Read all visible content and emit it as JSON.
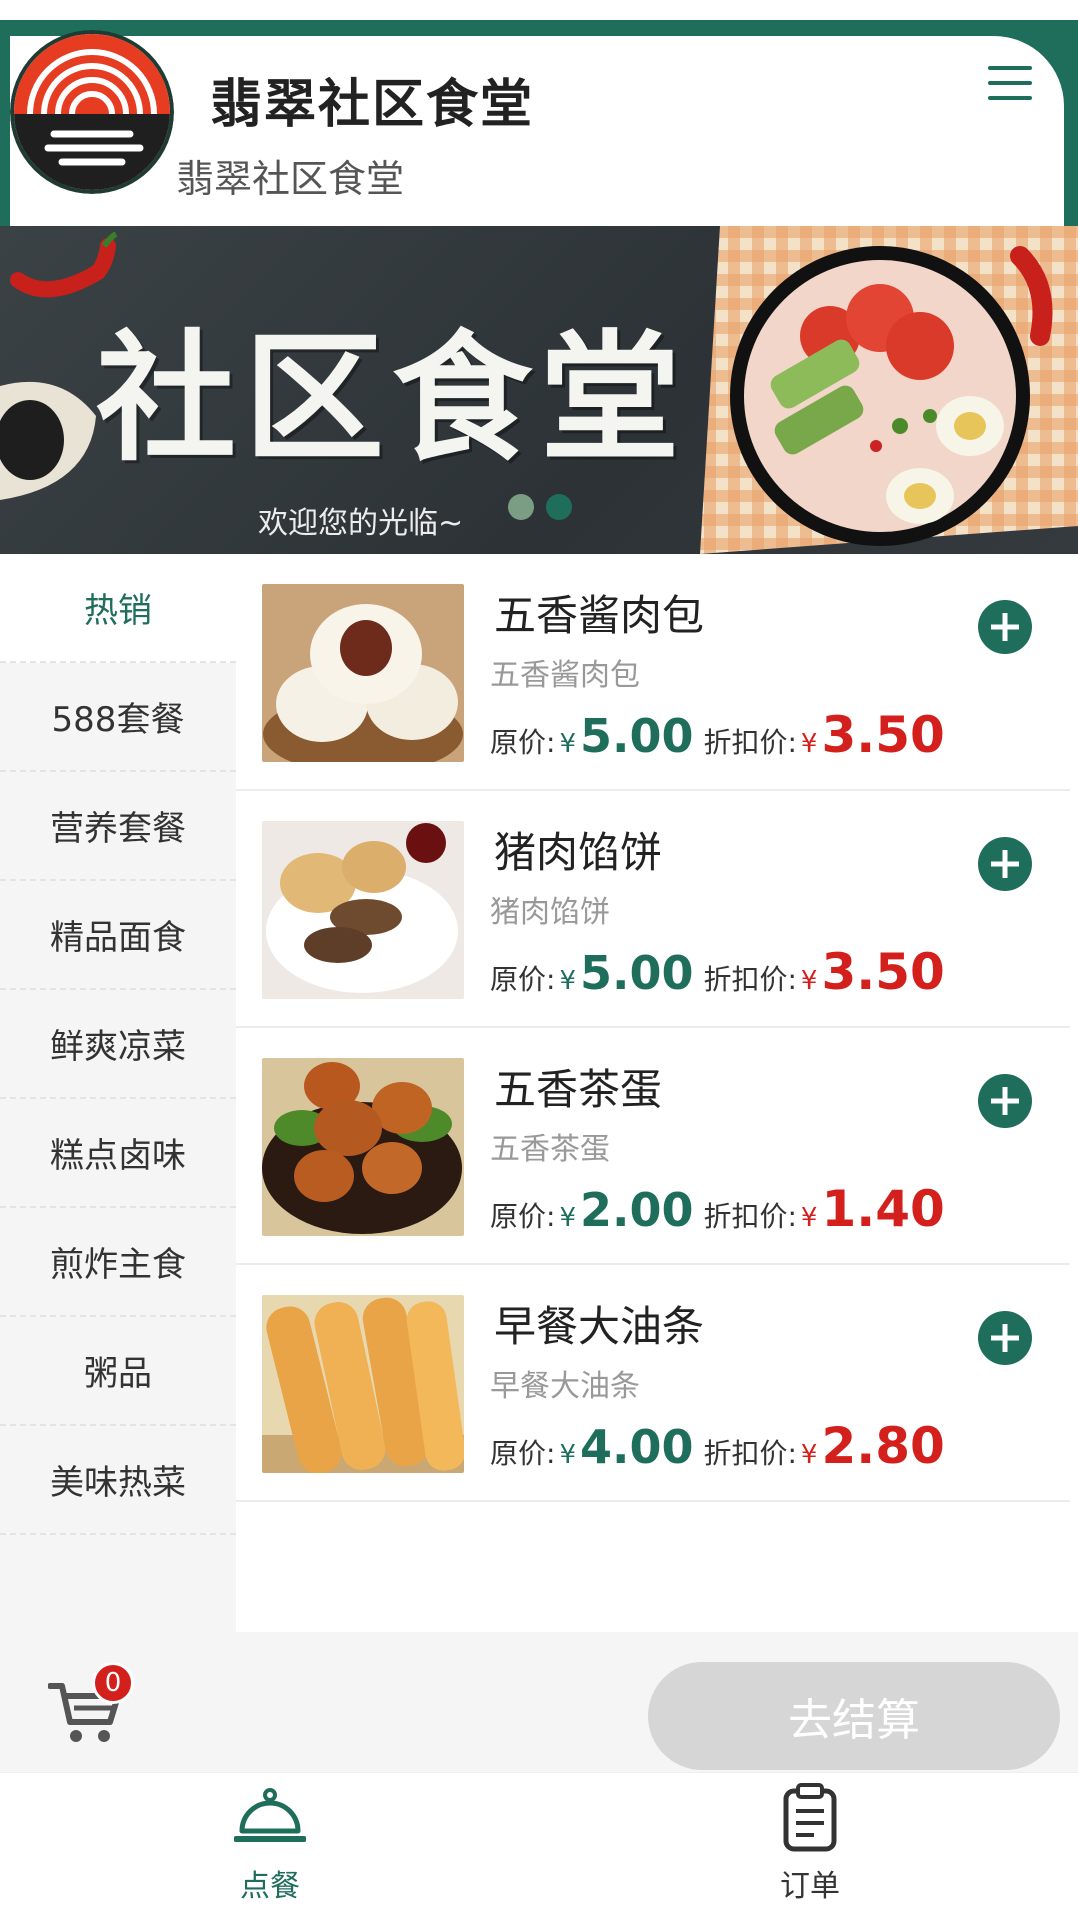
{
  "header": {
    "title": "翡翠社区食堂",
    "subtitle": "翡翠社区食堂",
    "logo_icon": "canteen-logo",
    "menu_icon": "hamburger-menu-icon",
    "accent_color": "#1f6e5c"
  },
  "banner": {
    "title": "社区食堂",
    "subtitle": "欢迎您的光临~",
    "slide_count": 2,
    "active_slide": 2
  },
  "categories": [
    {
      "label": "热销",
      "active": true
    },
    {
      "label": "588套餐"
    },
    {
      "label": "营养套餐"
    },
    {
      "label": "精品面食"
    },
    {
      "label": "鲜爽凉菜"
    },
    {
      "label": "糕点卤味"
    },
    {
      "label": "煎炸主食"
    },
    {
      "label": "粥品"
    },
    {
      "label": "美味热菜"
    }
  ],
  "price_labels": {
    "original": "原价:",
    "discount": "折扣价:",
    "currency": "¥"
  },
  "products": [
    {
      "name": "五香酱肉包",
      "subtitle": "五香酱肉包",
      "original_price": "5.00",
      "discount_price": "3.50",
      "image_icon": "steamed-bun-image"
    },
    {
      "name": "猪肉馅饼",
      "subtitle": "猪肉馅饼",
      "original_price": "5.00",
      "discount_price": "3.50",
      "image_icon": "meat-pie-image"
    },
    {
      "name": "五香茶蛋",
      "subtitle": "五香茶蛋",
      "original_price": "2.00",
      "discount_price": "1.40",
      "image_icon": "tea-egg-image"
    },
    {
      "name": "早餐大油条",
      "subtitle": "早餐大油条",
      "original_price": "4.00",
      "discount_price": "2.80",
      "image_icon": "fried-dough-stick-image"
    }
  ],
  "cart": {
    "count": "0",
    "icon": "shopping-cart-icon"
  },
  "checkout": {
    "label": "去结算",
    "enabled": false
  },
  "tabbar": {
    "tabs": [
      {
        "label": "点餐",
        "icon": "food-cloche-icon",
        "active": true
      },
      {
        "label": "订单",
        "icon": "order-clipboard-icon",
        "active": false
      }
    ]
  },
  "colors": {
    "primary": "#1f6e5c",
    "price_red": "#d4201c",
    "muted": "#999999"
  }
}
